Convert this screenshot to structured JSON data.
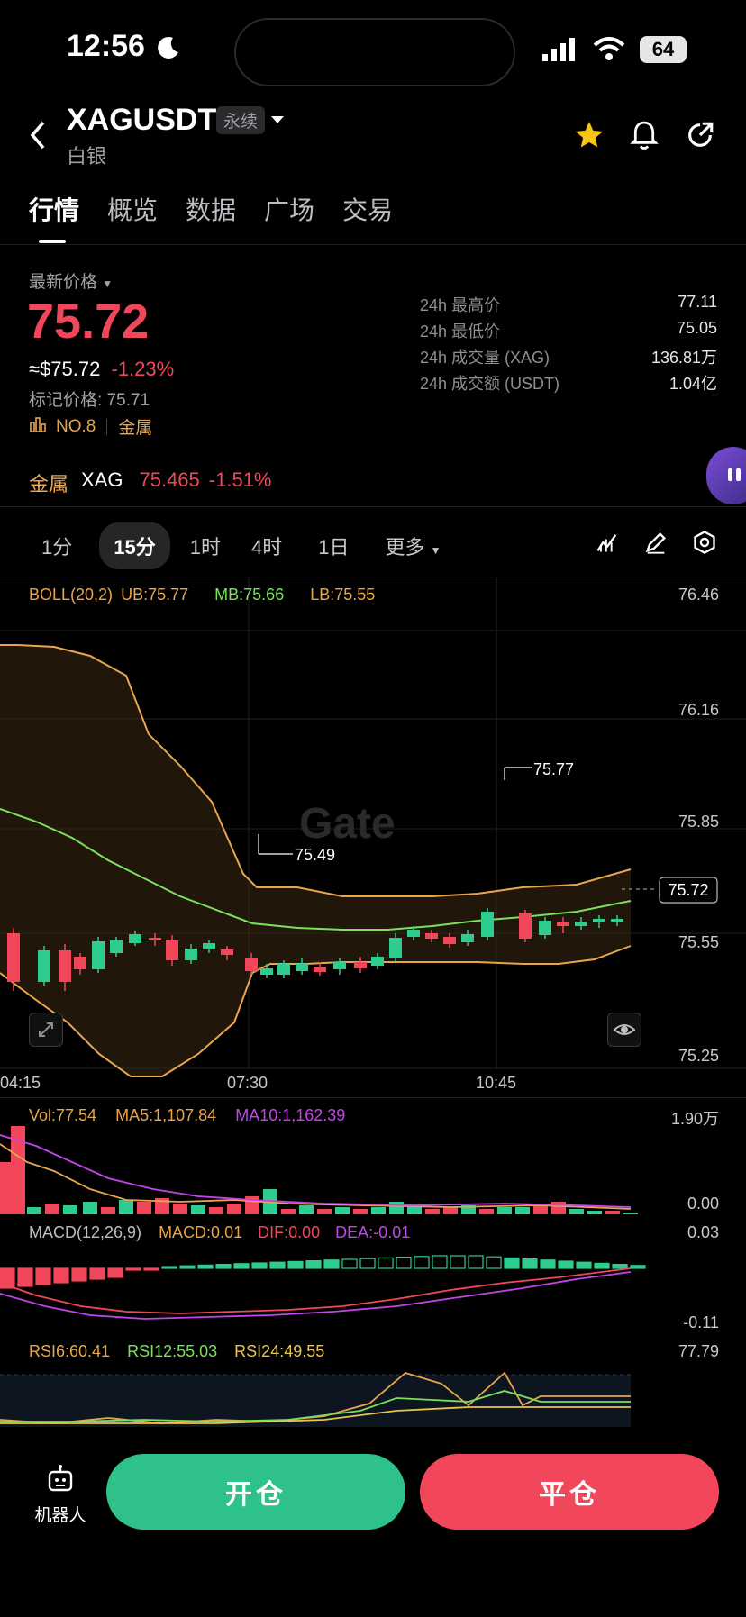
{
  "status_bar": {
    "time": "12:56",
    "battery": "64"
  },
  "header": {
    "symbol": "XAGUSDT",
    "contract_tag": "永续",
    "subtitle": "白银"
  },
  "tabs": [
    "行情",
    "概览",
    "数据",
    "广场",
    "交易"
  ],
  "price": {
    "latest_label": "最新价格",
    "last": "75.72",
    "usd": "≈$75.72",
    "change": "-1.23%",
    "mark": "标记价格: 75.71",
    "rank": "NO.8",
    "category": "金属"
  },
  "stats": [
    {
      "label": "24h 最高价",
      "value": "77.11"
    },
    {
      "label": "24h 最低价",
      "value": "75.05"
    },
    {
      "label": "24h 成交量 (XAG)",
      "value": "136.81万"
    },
    {
      "label": "24h 成交额 (USDT)",
      "value": "1.04亿"
    }
  ],
  "ticker": {
    "category": "金属",
    "symbol": "XAG",
    "price": "75.465",
    "change": "-1.51%"
  },
  "timeframes": [
    "1分",
    "15分",
    "1时",
    "4时",
    "1日",
    "更多"
  ],
  "boll": {
    "title": "BOLL(20,2)",
    "ub": "UB:75.77",
    "mb": "MB:75.66",
    "lb": "LB:75.55"
  },
  "price_axis": [
    "76.46",
    "76.16",
    "75.85",
    "75.55",
    "75.25"
  ],
  "current_price_tag": "75.72",
  "high_mark": "75.77",
  "low_mark": "75.49",
  "watermark": "Gate",
  "time_axis": [
    "04:15",
    "07:30",
    "10:45"
  ],
  "volume": {
    "vol": "Vol:77.54",
    "ma5": "MA5:1,107.84",
    "ma10": "MA10:1,162.39",
    "axis_top": "1.90万",
    "axis_bottom": "0.00"
  },
  "macd": {
    "title": "MACD(12,26,9)",
    "macd": "MACD:0.01",
    "dif": "DIF:0.00",
    "dea": "DEA:-0.01",
    "axis_top": "0.03",
    "axis_bottom": "-0.11"
  },
  "rsi": {
    "rsi6": "RSI6:60.41",
    "rsi12": "RSI12:55.03",
    "rsi24": "RSI24:49.55",
    "axis_top": "77.79"
  },
  "bottom": {
    "robot": "机器人",
    "open": "开仓",
    "close": "平仓"
  },
  "colors": {
    "up": "#2ecc8f",
    "down": "#f2475b",
    "boll_upper": "#e8a54b",
    "boll_mid": "#7be05a",
    "ma10": "#c145e8"
  }
}
